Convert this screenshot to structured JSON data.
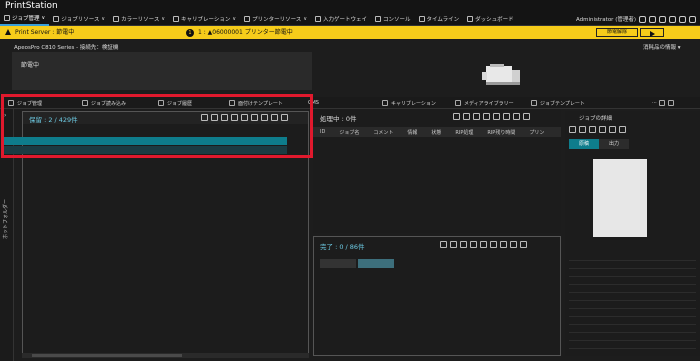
{
  "app": {
    "title": "PrintStation"
  },
  "menu": [
    {
      "label": "ジョブ管理",
      "icon": "job-icon",
      "active": true
    },
    {
      "label": "ジョブリソース",
      "icon": "resource-icon",
      "active": false
    },
    {
      "label": "カラーリソース",
      "icon": "color-icon",
      "active": false
    },
    {
      "label": "キャリブレーション",
      "icon": "calibration-icon",
      "active": false
    },
    {
      "label": "プリンターリソース",
      "icon": "printer-resource-icon",
      "active": false
    },
    {
      "label": "入力ゲートウェイ",
      "icon": "gateway-icon",
      "active": false
    },
    {
      "label": "コンソール",
      "icon": "console-icon",
      "active": false
    },
    {
      "label": "タイムライン",
      "icon": "timeline-icon",
      "active": false
    },
    {
      "label": "ダッシュボード",
      "icon": "dashboard-icon",
      "active": false
    }
  ],
  "user": {
    "label": "Administrator (管理者)"
  },
  "alert": {
    "server": "Print Server : 節電中",
    "count": "1",
    "message": "1 : ▲06000001 プリンター節電中",
    "button": "節電解除",
    "color": "#f6cc1a"
  },
  "device": {
    "name": "ApeosPro C810 Series - 接続先：検証機",
    "consumables": "消耗品の情報 ▾",
    "status": "節電中"
  },
  "toolbar": {
    "job_management": "ジョブ管理",
    "job_read": "ジョブ読み込み",
    "job_history": "ジョブ履歴",
    "imposition": "面付けテンプレート",
    "cms": "CMS",
    "calibration": "キャリブレーション",
    "media_library": "メディアライブラリー",
    "job_template": "ジョブテンプレート"
  },
  "left_strip": {
    "label": "ホットフォルダー"
  },
  "hold_panel": {
    "title": "保留 : 2 / 429件"
  },
  "processing_panel": {
    "title": "処理中 : 0件",
    "columns": [
      "ID",
      "ジョブ名",
      "コメント",
      "情報",
      "状態",
      "RIP処理",
      "RIP残り時間",
      "プリン"
    ]
  },
  "done_panel": {
    "title": "完了 : 0 / 86件"
  },
  "details_panel": {
    "title": "ジョブの詳細",
    "tabs": [
      {
        "label": "原稿",
        "active": true
      },
      {
        "label": "出力",
        "active": false
      }
    ]
  },
  "colors": {
    "accent": "#3aa0d8",
    "teal": "#0e7d8c",
    "highlight_box": "#e0192d"
  }
}
